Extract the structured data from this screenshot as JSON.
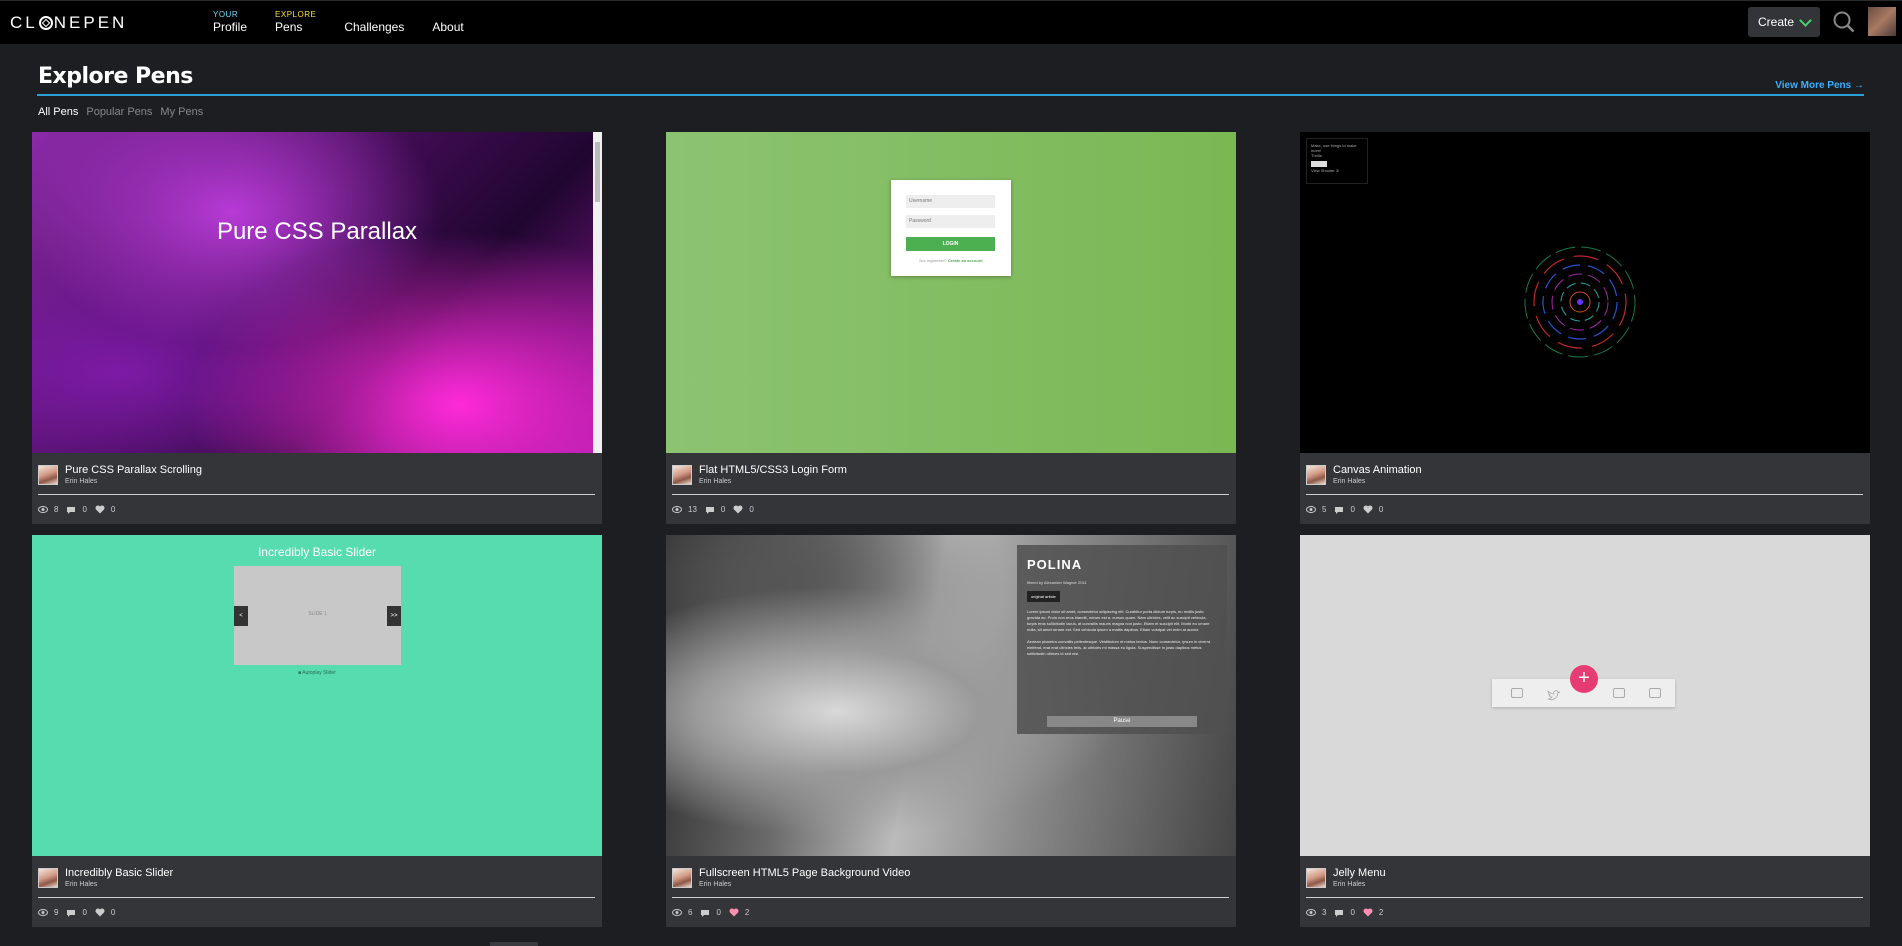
{
  "header": {
    "logo_text": "CLONEPEN",
    "nav": [
      {
        "small": "YOUR",
        "label": "Profile"
      },
      {
        "small": "EXPLORE",
        "label": "Pens"
      },
      {
        "small": "",
        "label": "Challenges"
      },
      {
        "small": "",
        "label": "About"
      }
    ],
    "create_label": "Create",
    "icons": {
      "search": "search-icon",
      "create_chevron": "chevron-down-icon"
    }
  },
  "section": {
    "title": "Explore Pens",
    "view_more": "View More Pens →",
    "tabs": [
      "All Pens",
      "Popular Pens",
      "My Pens"
    ],
    "active_tab": "All Pens",
    "accent": "#2d9fd8"
  },
  "pens": [
    {
      "title": "Pure CSS Parallax Scrolling",
      "author": "Erin Hales",
      "views": "8",
      "comments": "0",
      "likes": "0",
      "preview_text": "Pure CSS Parallax"
    },
    {
      "title": "Flat HTML5/CSS3 Login Form",
      "author": "Erin Hales",
      "views": "13",
      "comments": "0",
      "likes": "0",
      "preview": {
        "username": "Username",
        "password": "Password",
        "button": "LOGIN",
        "note": "Not registered?",
        "note_link": "Create an account"
      }
    },
    {
      "title": "Canvas Animation",
      "author": "Erin Hales",
      "views": "5",
      "comments": "0",
      "likes": "0",
      "preview": {
        "line1": "Make, use things to make more!",
        "line2": "Thrills:",
        "button": "Shoot",
        "line3": "View Shooter 3!"
      }
    },
    {
      "title": "Incredibly Basic Slider",
      "author": "Erin Hales",
      "views": "9",
      "comments": "0",
      "likes": "0",
      "preview": {
        "heading": "Incredibly Basic Slider",
        "slide": "SLIDE 1",
        "prev": "<",
        "next": ">>",
        "autoplay": "Autoplay Slider"
      }
    },
    {
      "title": "Fullscreen HTML5 Page Background Video",
      "author": "Erin Hales",
      "views": "6",
      "comments": "0",
      "likes": "2",
      "preview": {
        "heading": "POLINA",
        "byline": "filmed by Alexander Wagner 2011",
        "tag": "original article",
        "para1": "Lorem ipsum dolor sit amet, consectetur adipiscing elit. Curabitur porta dictum turpis, eu mollis justo gravida ac. Proin non eros blandit, rutrum est a, cursus quam. Nam ultricies, velit ac suscipit vehicula, turpis eros sollicitudin lacus, at convallis mauris magna non justo. Etiam et suscipit elit. Morbi eu ornare nulla, sit amet ornare est. Sed vehicula ipsum a mattis dapibus. Etiam volutpat vel enim at auctor.",
        "para2": "Aenean pharetra convallis pellentesque. Vestibulum et metus lectus. Nunc consectetur, ipsum in viverra eleifend, erat erat ultricies felis, at ultricies mi massa eu ligula. Suspendisse in justo dapibus metus sollicitudin ultrices id sed nisi.",
        "button": "Pause"
      }
    },
    {
      "title": "Jelly Menu",
      "author": "Erin Hales",
      "views": "3",
      "comments": "0",
      "likes": "2",
      "preview": {
        "button": "+"
      }
    }
  ],
  "colors": {
    "like_active": "#ff8fb1",
    "stat_icon": "#cccccc"
  }
}
